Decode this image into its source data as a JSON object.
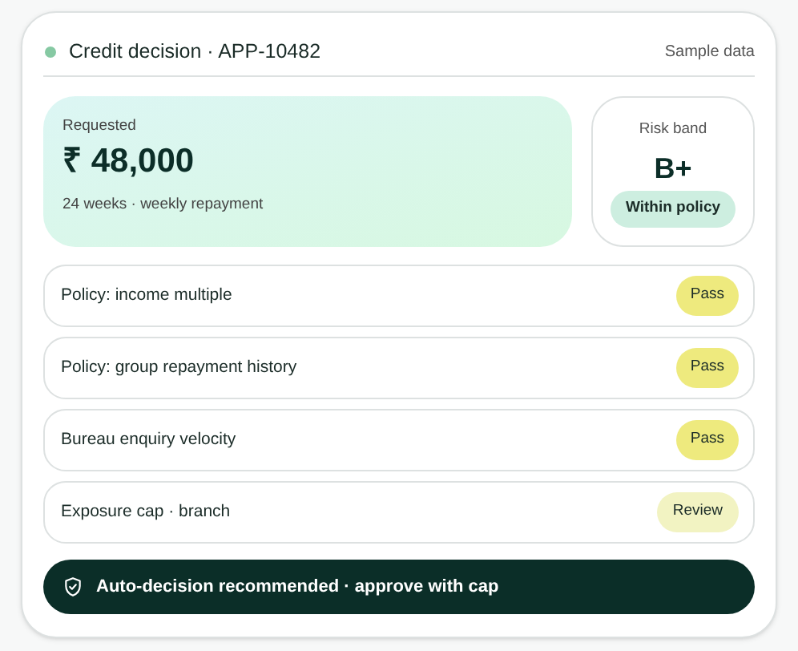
{
  "header": {
    "title": "Credit decision · APP-10482",
    "active": true,
    "note": "Sample data"
  },
  "requested": {
    "label": "Requested",
    "amount": "₹ 48,000",
    "terms": "24 weeks · weekly repayment"
  },
  "risk": {
    "label": "Risk band",
    "band": "B+",
    "badge": "Within policy"
  },
  "checks": [
    {
      "label": "Policy: income multiple",
      "result": "Pass",
      "kind": "pass"
    },
    {
      "label": "Policy: group repayment history",
      "result": "Pass",
      "kind": "pass"
    },
    {
      "label": "Bureau enquiry velocity",
      "result": "Pass",
      "kind": "pass"
    },
    {
      "label": "Exposure cap · branch",
      "result": "Review",
      "kind": "review"
    }
  ],
  "recommendation": {
    "text": "Auto-decision recommended · approve with cap"
  }
}
